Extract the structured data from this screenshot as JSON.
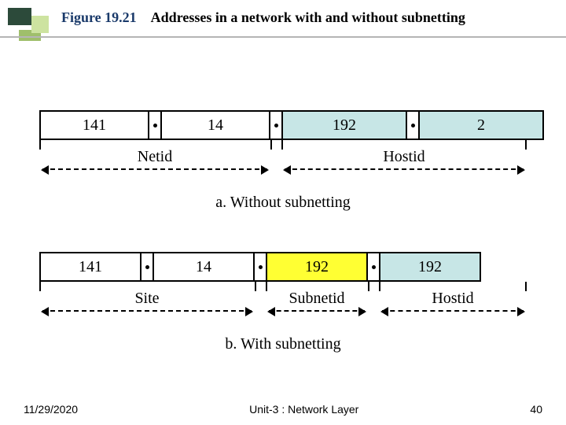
{
  "header": {
    "figure_no": "Figure 19.21",
    "figure_title": "Addresses in a network with and without subnetting"
  },
  "diagram_a": {
    "octets": [
      "141",
      "14",
      "192",
      "2"
    ],
    "labels": {
      "netid": "Netid",
      "hostid": "Hostid"
    },
    "caption": "a. Without subnetting"
  },
  "diagram_b": {
    "octets": [
      "141",
      "14",
      "192",
      "192"
    ],
    "labels": {
      "site": "Site",
      "subnetid": "Subnetid",
      "hostid": "Hostid"
    },
    "caption": "b. With subnetting"
  },
  "footer": {
    "date": "11/29/2020",
    "unit": "Unit-3 : Network Layer",
    "page": "40"
  }
}
